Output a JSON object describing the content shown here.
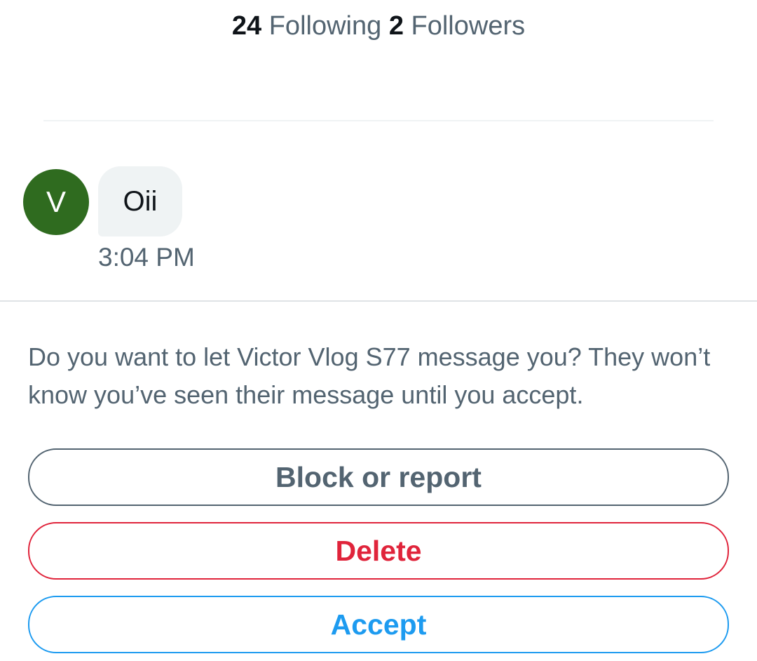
{
  "profile_stats": {
    "following_count": "24",
    "following_label": "Following",
    "followers_count": "2",
    "followers_label": "Followers"
  },
  "message": {
    "avatar_initial": "V",
    "avatar_color": "#2f6b1f",
    "text": "Oii",
    "timestamp": "3:04 PM"
  },
  "request": {
    "prompt": "Do you want to let Victor Vlog S77 message you? They won’t know you’ve seen their message until you accept."
  },
  "actions": {
    "block_label": "Block or report",
    "delete_label": "Delete",
    "accept_label": "Accept"
  },
  "colors": {
    "text_primary": "#0f1419",
    "text_secondary": "#536471",
    "bubble_bg": "#eff3f4",
    "danger": "#e0243b",
    "accent": "#1d9bf0"
  }
}
